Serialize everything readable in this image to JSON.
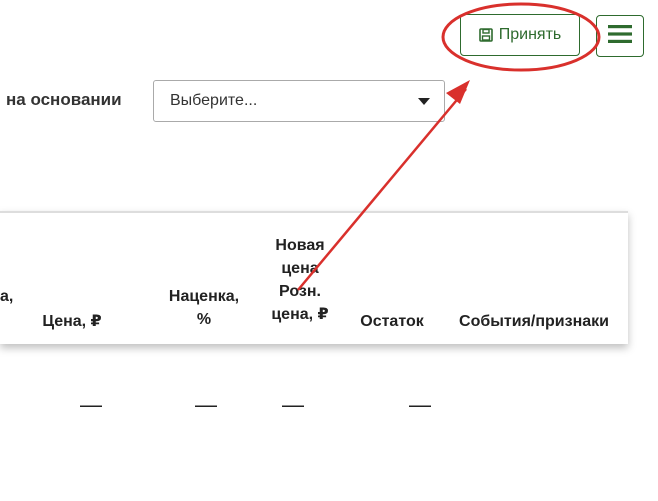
{
  "toolbar": {
    "accept_label": "Принять",
    "accept_icon": "save-icon",
    "menu_icon": "hamburger-icon",
    "accent_color": "#2e6b2e"
  },
  "basis": {
    "label": "на основании",
    "select_value": "Выберите..."
  },
  "table": {
    "columns": [
      "а,",
      "Цена, ₽",
      "Наценка,\n%",
      "Новая\nцена\nРозн.\nцена, ₽",
      "Остаток",
      "События/признаки"
    ],
    "row_values": [
      "—",
      "—",
      "—",
      "—"
    ]
  },
  "annotation": {
    "color": "#d9302c"
  }
}
